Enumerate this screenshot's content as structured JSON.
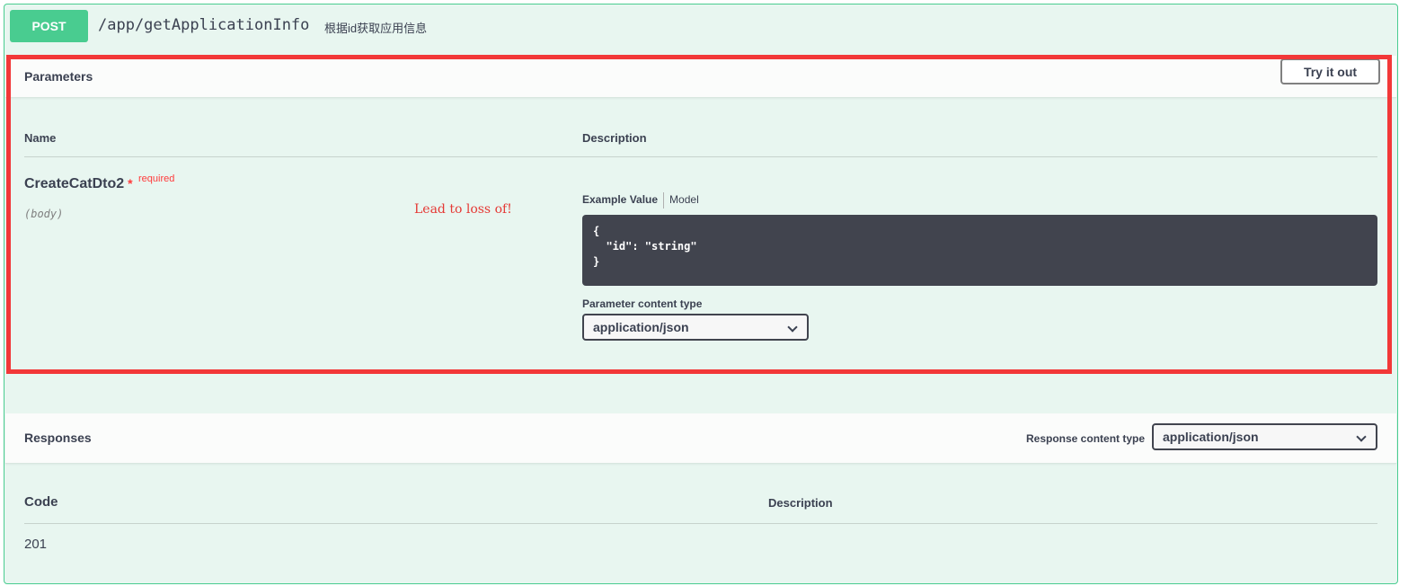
{
  "summary": {
    "method": "POST",
    "path": "/app/getApplicationInfo",
    "description": "根据id获取应用信息"
  },
  "parameters": {
    "title": "Parameters",
    "try_label": "Try it out",
    "col_name": "Name",
    "col_description": "Description",
    "param": {
      "name": "CreateCatDto2",
      "star": "*",
      "required": "required",
      "in": "(body)"
    },
    "annotation": "Lead to loss of!",
    "tab_example": "Example Value",
    "tab_model": "Model",
    "example_code": "{\n  \"id\": \"string\"\n}",
    "content_type_label": "Parameter content type",
    "content_type_value": "application/json"
  },
  "responses": {
    "title": "Responses",
    "content_type_label": "Response content type",
    "content_type_value": "application/json",
    "col_code": "Code",
    "col_description": "Description",
    "rows": [
      {
        "code": "201",
        "description": ""
      }
    ]
  },
  "colors": {
    "post_green": "#49cc90",
    "block_bg": "#e8f6f0",
    "highlight_red": "#f23838",
    "code_bg": "#41444e"
  }
}
